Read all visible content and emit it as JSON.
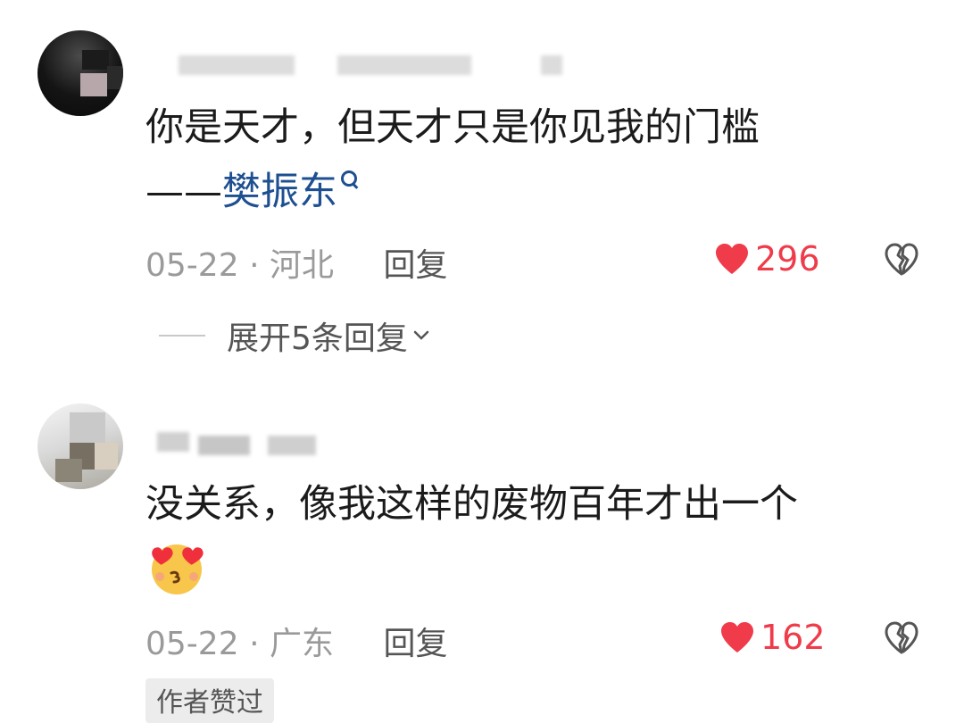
{
  "comments": [
    {
      "text": "你是天才，但天才只是你见我的门槛",
      "text_line2_prefix": "——",
      "link": "樊振东",
      "date": "05-22",
      "separator": "·",
      "location": "河北",
      "reply_label": "回复",
      "likes": "296",
      "expand_label": "展开5条回复"
    },
    {
      "text": "没关系，像我这样的废物百年才出一个",
      "date": "05-22",
      "separator": "·",
      "location": "广东",
      "reply_label": "回复",
      "likes": "162",
      "author_badge": "作者赞过"
    }
  ],
  "colors": {
    "like": "#ef3b4a",
    "link": "#1d4f91",
    "meta": "#9a9a9a"
  },
  "icons": [
    "heart-icon",
    "broken-heart-icon",
    "search-icon",
    "chevron-down-icon",
    "heart-eyes-kiss-emoji"
  ]
}
